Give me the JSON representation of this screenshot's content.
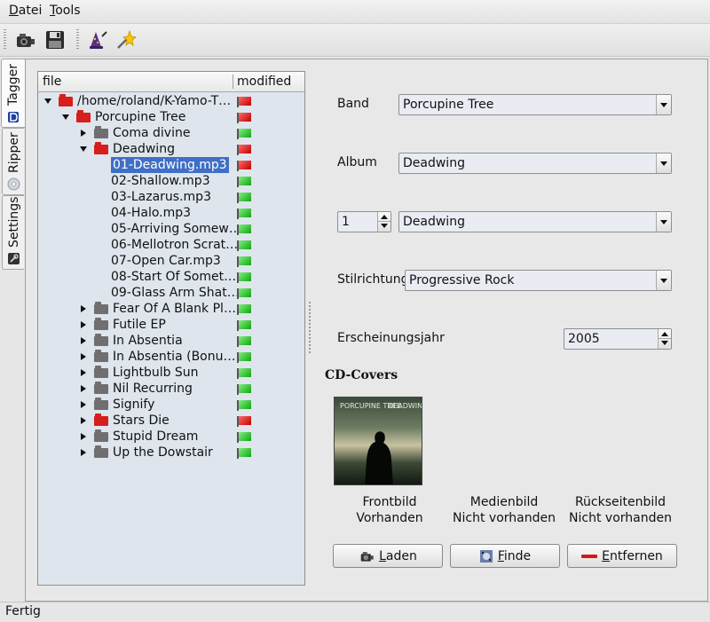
{
  "menubar": {
    "items": [
      {
        "mnemonic": "D",
        "rest": "atei"
      },
      {
        "mnemonic": "T",
        "rest": "ools"
      }
    ]
  },
  "toolbar": {
    "buttons": [
      "camera-icon",
      "save-icon",
      "wizard-icon",
      "star-wand-icon"
    ]
  },
  "side_tabs": [
    {
      "label": "Tagger",
      "icon": "tag-icon"
    },
    {
      "label": "Ripper",
      "icon": "cd-icon"
    },
    {
      "label": "Settings",
      "icon": "settings-icon"
    }
  ],
  "tree": {
    "columns": [
      "file",
      "modified"
    ],
    "rows": [
      {
        "label": "/home/roland/K-Yamo-T…",
        "depth": 0,
        "expander": "open",
        "folder": "red",
        "flag": "red"
      },
      {
        "label": "Porcupine Tree",
        "depth": 1,
        "expander": "open",
        "folder": "red",
        "flag": "red"
      },
      {
        "label": "Coma divine",
        "depth": 2,
        "expander": "closed",
        "folder": "gray",
        "flag": "green"
      },
      {
        "label": "Deadwing",
        "depth": 2,
        "expander": "open",
        "folder": "red",
        "flag": "red"
      },
      {
        "label": "01-Deadwing.mp3",
        "depth": 3,
        "expander": "",
        "folder": "",
        "flag": "red",
        "selected": true
      },
      {
        "label": "02-Shallow.mp3",
        "depth": 3,
        "expander": "",
        "folder": "",
        "flag": "green"
      },
      {
        "label": "03-Lazarus.mp3",
        "depth": 3,
        "expander": "",
        "folder": "",
        "flag": "green"
      },
      {
        "label": "04-Halo.mp3",
        "depth": 3,
        "expander": "",
        "folder": "",
        "flag": "green"
      },
      {
        "label": "05-Arriving Somew…",
        "depth": 3,
        "expander": "",
        "folder": "",
        "flag": "green"
      },
      {
        "label": "06-Mellotron Scrat…",
        "depth": 3,
        "expander": "",
        "folder": "",
        "flag": "green"
      },
      {
        "label": "07-Open Car.mp3",
        "depth": 3,
        "expander": "",
        "folder": "",
        "flag": "green"
      },
      {
        "label": "08-Start Of Somet…",
        "depth": 3,
        "expander": "",
        "folder": "",
        "flag": "green"
      },
      {
        "label": "09-Glass Arm Shat…",
        "depth": 3,
        "expander": "",
        "folder": "",
        "flag": "green"
      },
      {
        "label": "Fear Of A Blank Pl…",
        "depth": 2,
        "expander": "closed",
        "folder": "gray",
        "flag": "green"
      },
      {
        "label": "Futile EP",
        "depth": 2,
        "expander": "closed",
        "folder": "gray",
        "flag": "green"
      },
      {
        "label": "In Absentia",
        "depth": 2,
        "expander": "closed",
        "folder": "gray",
        "flag": "green"
      },
      {
        "label": "In Absentia (Bonu…",
        "depth": 2,
        "expander": "closed",
        "folder": "gray",
        "flag": "green"
      },
      {
        "label": "Lightbulb Sun",
        "depth": 2,
        "expander": "closed",
        "folder": "gray",
        "flag": "green"
      },
      {
        "label": "Nil Recurring",
        "depth": 2,
        "expander": "closed",
        "folder": "gray",
        "flag": "green"
      },
      {
        "label": "Signify",
        "depth": 2,
        "expander": "closed",
        "folder": "gray",
        "flag": "green"
      },
      {
        "label": "Stars Die",
        "depth": 2,
        "expander": "closed",
        "folder": "red",
        "flag": "red"
      },
      {
        "label": "Stupid Dream",
        "depth": 2,
        "expander": "closed",
        "folder": "gray",
        "flag": "green"
      },
      {
        "label": "Up the Dowstair",
        "depth": 2,
        "expander": "closed",
        "folder": "gray",
        "flag": "green"
      }
    ]
  },
  "form": {
    "band_label": "Band",
    "band_value": "Porcupine Tree",
    "album_label": "Album",
    "album_value": "Deadwing",
    "track_number": "1",
    "track_title": "Deadwing",
    "genre_label": "Stilrichtung",
    "genre_value": "Progressive Rock",
    "year_label": "Erscheinungsjahr",
    "year_value": "2005"
  },
  "covers": {
    "heading": "CD-Covers",
    "front_title": "Frontbild",
    "front_status": "Vorhanden",
    "media_title": "Medienbild",
    "media_status": "Nicht vorhanden",
    "back_title": "Rückseitenbild",
    "back_status": "Nicht vorhanden",
    "cover_text_left": "PORCUPINE TREE",
    "cover_text_right": "DEADWING"
  },
  "buttons": {
    "load_mnemonic": "L",
    "load_rest": "aden",
    "find_mnemonic": "F",
    "find_rest": "inde",
    "remove_mnemonic": "E",
    "remove_rest": "ntfernen"
  },
  "status": {
    "text": "Fertig"
  }
}
